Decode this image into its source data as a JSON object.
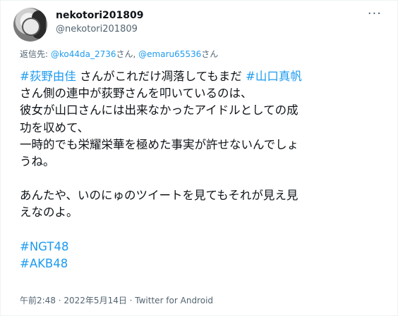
{
  "user": {
    "display_name": "nekotori201809",
    "handle": "@nekotori201809"
  },
  "more_label": "···",
  "reply": {
    "prefix": "返信先: ",
    "mention1": "@ko44da_2736",
    "suffix1": "さん, ",
    "mention2": "@emaru65536",
    "suffix2": "さん"
  },
  "tweet": {
    "tag1": "#荻野由佳",
    "line1_mid": " さんがこれだけ凋落してもまだ ",
    "tag2": "#山口真帆",
    "line2": "さん側の連中が荻野さんを叩いているのは、",
    "line3": "彼女が山口さんには出来なかったアイドルとしての成",
    "line4": "功を収めて、",
    "line5": "一時的でも栄耀栄華を極めた事実が許せないんでしょ",
    "line6": "うね。",
    "line7": "あんたや、いのにゅのツイートを見てもそれが見え見",
    "line8": "えなのよ。",
    "tag3": "#NGT48",
    "tag4": "#AKB48"
  },
  "meta": {
    "text": "午前2:48 · 2022年5月14日 · Twitter for Android"
  }
}
